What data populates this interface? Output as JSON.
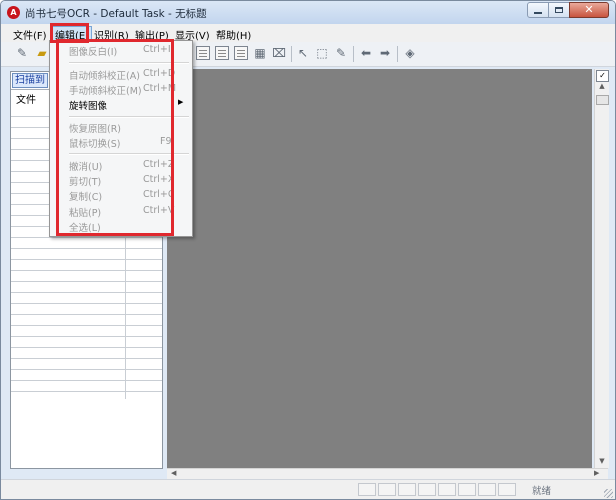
{
  "window": {
    "title": "尚书七号OCR - Default Task - 无标题",
    "app_icon_label": "A"
  },
  "menubar": {
    "items": [
      "文件(F)",
      "编辑(E)",
      "识别(R)",
      "输出(P)",
      "显示(V)",
      "帮助(H)"
    ],
    "active": "编辑(E)"
  },
  "left_pane": {
    "tab_label": "扫描到",
    "column_header": "文件"
  },
  "edit_menu": {
    "items": [
      {
        "label": "图像反白(I)",
        "shortcut": "Ctrl+I",
        "enabled": false
      },
      {
        "label": "自动倾斜校正(A)",
        "shortcut": "Ctrl+D",
        "enabled": false
      },
      {
        "label": "手动倾斜校正(M)",
        "shortcut": "Ctrl+M",
        "enabled": false
      },
      {
        "label": "旋转图像",
        "shortcut": "",
        "enabled": true,
        "submenu": true
      },
      {
        "label": "恢复原图(R)",
        "shortcut": "",
        "enabled": false
      },
      {
        "label": "鼠标切换(S)",
        "shortcut": "F9",
        "enabled": false
      },
      {
        "label": "撤消(U)",
        "shortcut": "Ctrl+Z",
        "enabled": false
      },
      {
        "label": "剪切(T)",
        "shortcut": "Ctrl+X",
        "enabled": false
      },
      {
        "label": "复制(C)",
        "shortcut": "Ctrl+C",
        "enabled": false
      },
      {
        "label": "粘贴(P)",
        "shortcut": "Ctrl+V",
        "enabled": false
      },
      {
        "label": "全选(L)",
        "shortcut": "",
        "enabled": false
      }
    ]
  },
  "statusbar": {
    "text": "就绪"
  },
  "colors": {
    "highlight": "#e0282e",
    "canvas": "#808080",
    "disabled_text": "#9a9a9a"
  }
}
